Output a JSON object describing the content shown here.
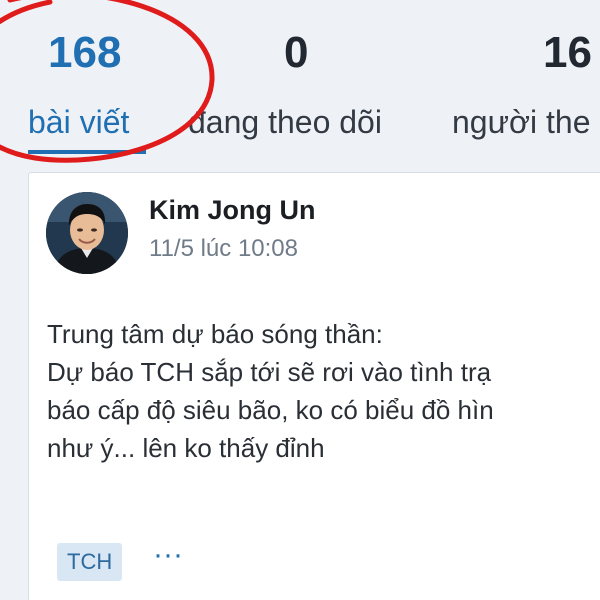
{
  "profile_stats": {
    "posts": {
      "value": "168",
      "label": "bài viết"
    },
    "following": {
      "value": "0",
      "label": "đang theo dõi"
    },
    "followers": {
      "value": "16",
      "label": "người the"
    }
  },
  "post": {
    "author": "Kim Jong Un",
    "time": "11/5 lúc 10:08",
    "lines": [
      "Trung tâm dự báo sóng thần:",
      "Dự báo TCH sắp tới sẽ rơi vào tình trạ",
      "báo cấp độ siêu bão, ko có biểu đồ hìn",
      "như ý... lên ko thấy đỉnh"
    ],
    "tag": "TCH",
    "more_label": "···"
  },
  "colors": {
    "accent": "#1f6fb2",
    "annotation": "#e01b1b"
  }
}
